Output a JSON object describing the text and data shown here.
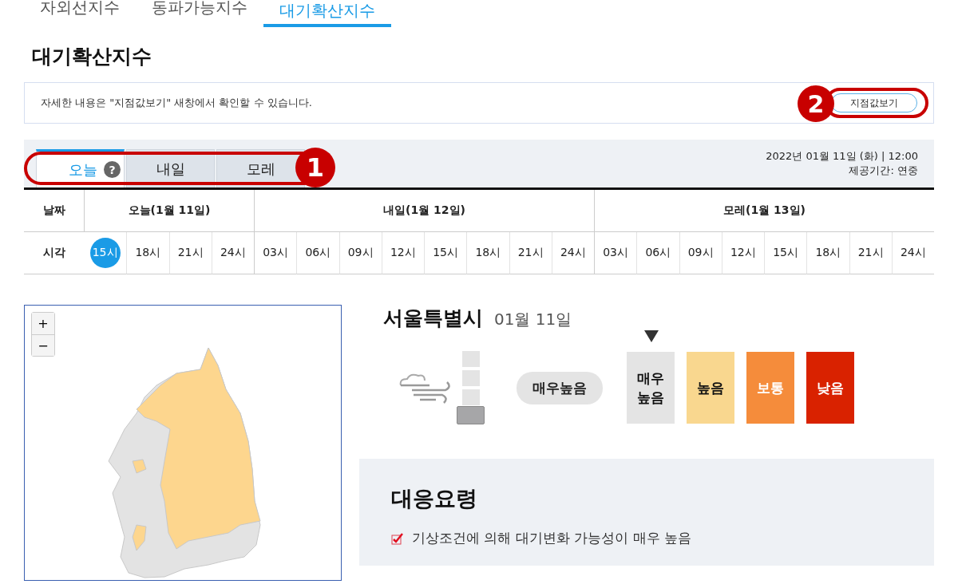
{
  "top_tabs": [
    {
      "label": "자외선지수",
      "selected": false
    },
    {
      "label": "동파가능지수",
      "selected": false
    },
    {
      "label": "대기확산지수",
      "selected": true
    }
  ],
  "heading": "대기확산지수",
  "notice": {
    "text": "자세한 내용은 \"지점값보기\" 새창에서 확인할 수 있습니다.",
    "button": "지점값보기",
    "callout": "2"
  },
  "day_tabs": {
    "callout": "1",
    "items": [
      {
        "label": "오늘",
        "selected": true,
        "help": "?"
      },
      {
        "label": "내일",
        "selected": false
      },
      {
        "label": "모레",
        "selected": false
      }
    ]
  },
  "issued": "2022년 01월 11일 (화) | 12:00",
  "period": "제공기간: 연중",
  "table": {
    "date_label": "날짜",
    "time_label": "시각",
    "days": [
      {
        "label": "오늘(1월 11일)",
        "times": [
          {
            "label": "15시",
            "selected": true
          },
          {
            "label": "18시",
            "selected": false
          },
          {
            "label": "21시",
            "selected": false
          },
          {
            "label": "24시",
            "selected": false
          }
        ]
      },
      {
        "label": "내일(1월 12일)",
        "times": [
          {
            "label": "03시",
            "selected": false
          },
          {
            "label": "06시",
            "selected": false
          },
          {
            "label": "09시",
            "selected": false
          },
          {
            "label": "12시",
            "selected": false
          },
          {
            "label": "15시",
            "selected": false
          },
          {
            "label": "18시",
            "selected": false
          },
          {
            "label": "21시",
            "selected": false
          },
          {
            "label": "24시",
            "selected": false
          }
        ]
      },
      {
        "label": "모레(1월 13일)",
        "times": [
          {
            "label": "03시",
            "selected": false
          },
          {
            "label": "06시",
            "selected": false
          },
          {
            "label": "09시",
            "selected": false
          },
          {
            "label": "12시",
            "selected": false
          },
          {
            "label": "15시",
            "selected": false
          },
          {
            "label": "18시",
            "selected": false
          },
          {
            "label": "21시",
            "selected": false
          },
          {
            "label": "24시",
            "selected": false
          }
        ]
      }
    ]
  },
  "map": {
    "zoom_in": "+",
    "zoom_out": "−"
  },
  "region": {
    "name": "서울특별시",
    "date": "01월 11일",
    "gauge": {
      "level": 0.25
    },
    "grade": "매우높음",
    "legend": [
      {
        "label": "매우 높음",
        "color": "#e4e4e4",
        "selected": true
      },
      {
        "label": "높음",
        "color": "#f9d78f",
        "selected": false
      },
      {
        "label": "보통",
        "color": "#f58c3b",
        "selected": false
      },
      {
        "label": "낮음",
        "color": "#d92200",
        "selected": false
      }
    ]
  },
  "response": {
    "title": "대응요령",
    "items": [
      {
        "text": "기상조건에 의해 대기변화 가능성이 매우 높음",
        "checked": true
      }
    ]
  }
}
